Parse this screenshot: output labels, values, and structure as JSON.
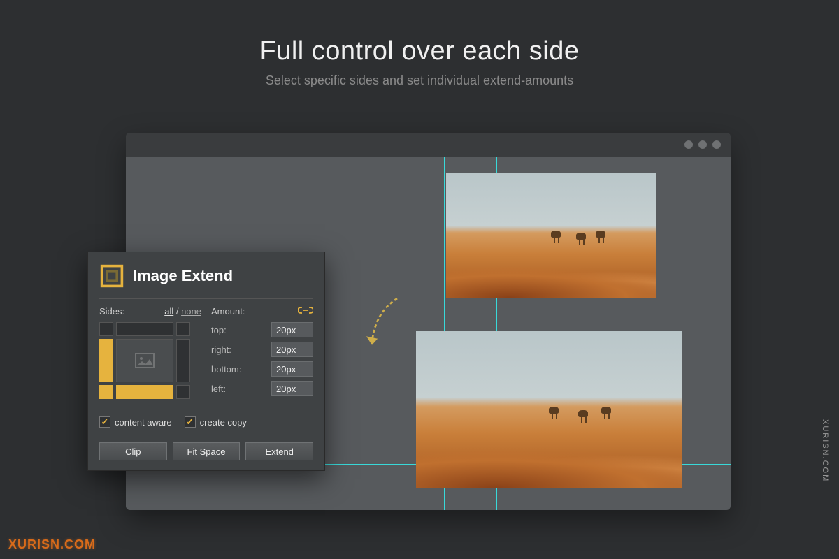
{
  "hero": {
    "title": "Full control over each side",
    "subtitle": "Select specific sides and set individual extend-amounts"
  },
  "panel": {
    "title": "Image Extend",
    "sides_label": "Sides:",
    "link_all": "all",
    "link_sep": " / ",
    "link_none": "none",
    "amount_label": "Amount:",
    "sides_selected": {
      "top": false,
      "right": false,
      "bottom": true,
      "left": true
    },
    "amounts": {
      "top": {
        "label": "top:",
        "value": "20px"
      },
      "right": {
        "label": "right:",
        "value": "20px"
      },
      "bottom": {
        "label": "bottom:",
        "value": "20px"
      },
      "left": {
        "label": "left:",
        "value": "20px"
      }
    },
    "content_aware_label": "content aware",
    "create_copy_label": "create copy",
    "content_aware_checked": true,
    "create_copy_checked": true,
    "btn_clip": "Clip",
    "btn_fit": "Fit Space",
    "btn_extend": "Extend"
  },
  "watermark": {
    "side": "XURISN.COM",
    "bottom": "XURISN.COM"
  }
}
